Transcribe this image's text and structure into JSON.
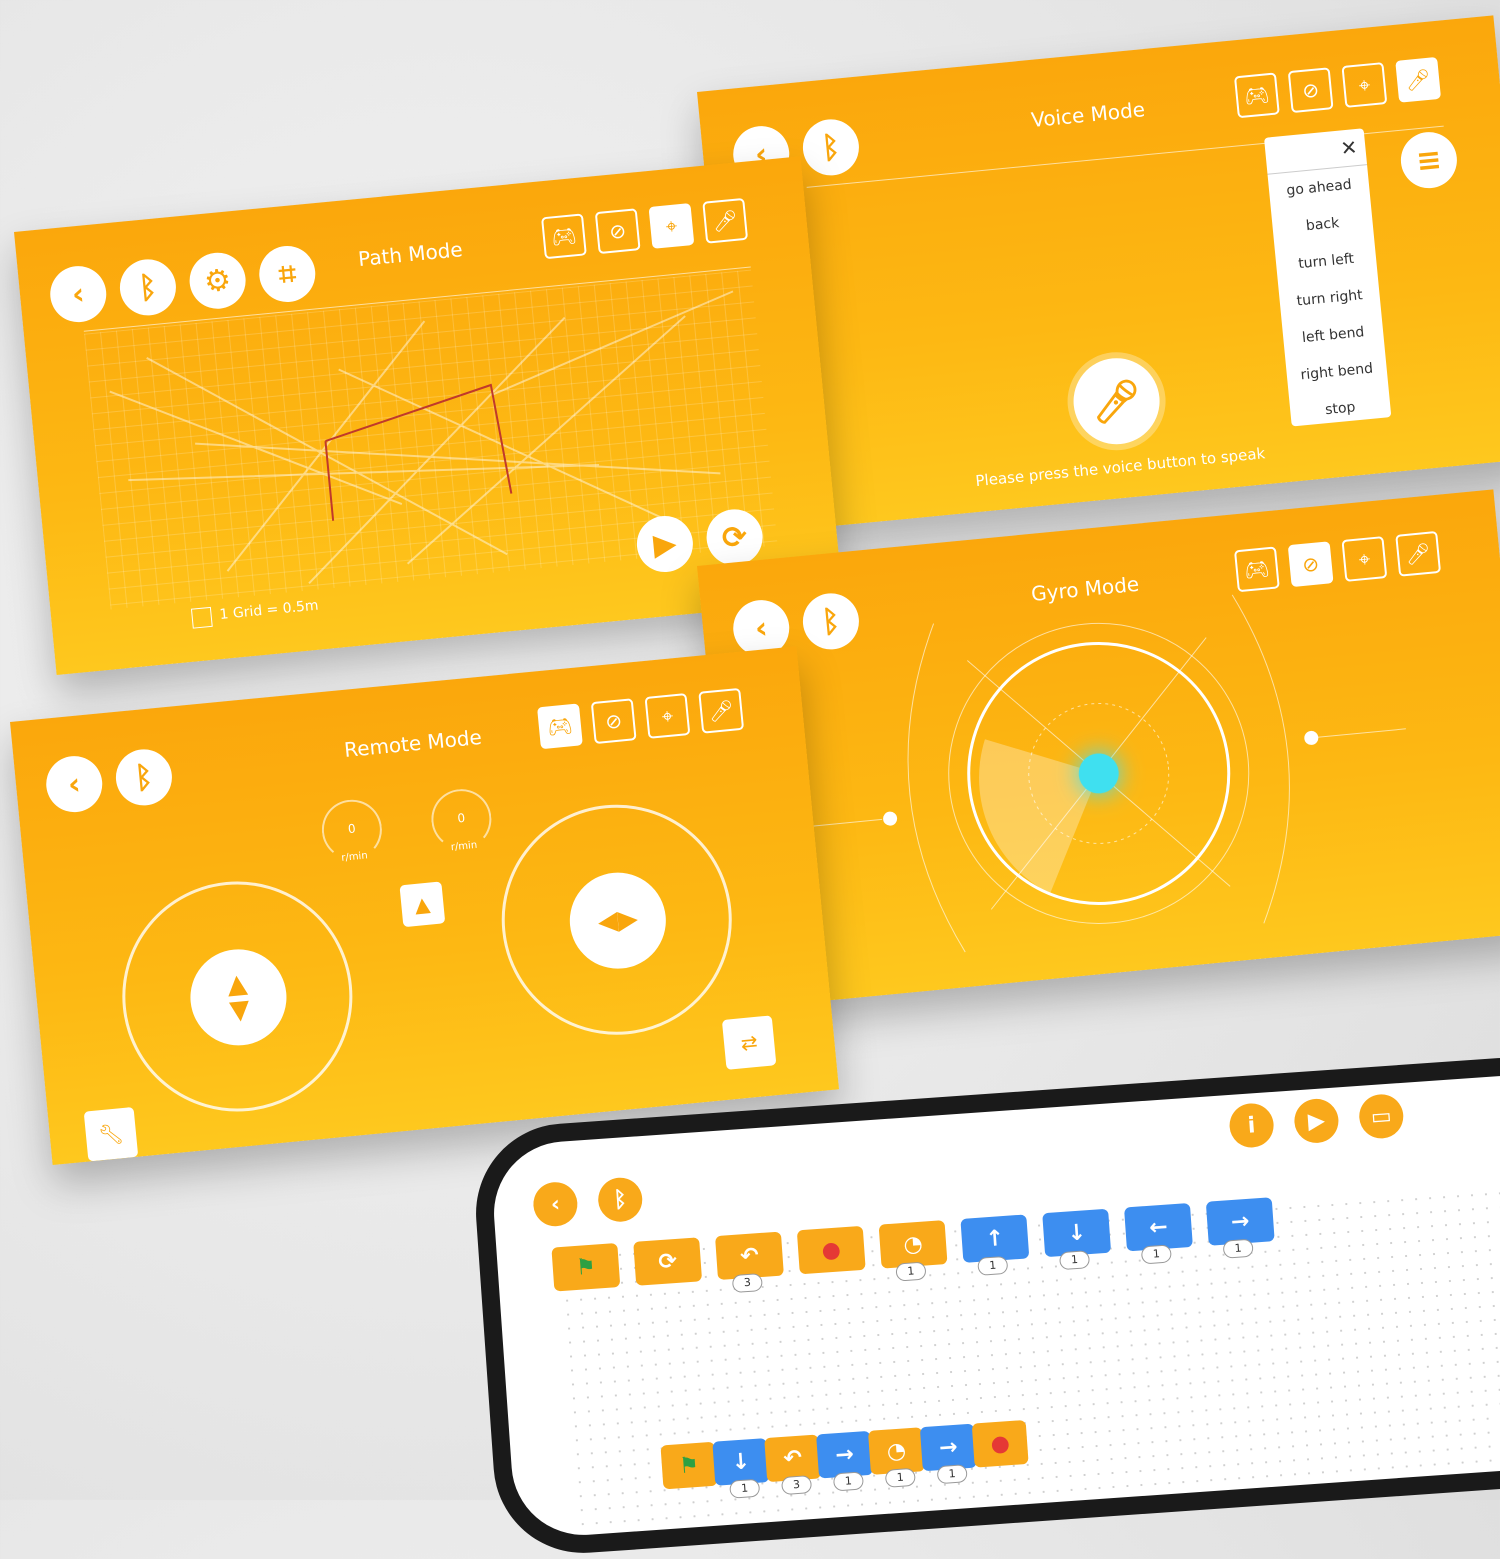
{
  "voice": {
    "title": "Voice Mode",
    "hint": "Please press the voice button to speak",
    "commands": [
      "go ahead",
      "back",
      "turn left",
      "turn right",
      "left bend",
      "right bend",
      "stop"
    ],
    "close": "✕"
  },
  "path": {
    "title": "Path Mode",
    "scale_label": "1 Grid = 0.5m"
  },
  "gyro": {
    "title": "Gyro Mode"
  },
  "remote": {
    "title": "Remote Mode",
    "left_speed": "0",
    "right_speed": "0",
    "unit": "r/min"
  },
  "icons": {
    "back": "‹",
    "bluetooth": "ᛒ",
    "gear": "⚙",
    "crop": "⌗",
    "gamepad": "🎮︎",
    "gyro": "⊘",
    "path": "⌖",
    "mic": "🎤︎",
    "play": "▶",
    "refresh": "⟳",
    "menu": "≡",
    "wrench": "🔧︎",
    "swap": "⇄",
    "rocket": "▲",
    "info": "i",
    "save": "▭"
  },
  "coding": {
    "palette": [
      {
        "type": "flag",
        "color": "org",
        "icon": "⚑"
      },
      {
        "type": "loop",
        "color": "org",
        "icon": "⟳"
      },
      {
        "type": "repeat",
        "color": "org",
        "icon": "↶",
        "num": "3"
      },
      {
        "type": "stop",
        "color": "org",
        "icon": "●"
      },
      {
        "type": "wait",
        "color": "org",
        "icon": "◔",
        "num": "1"
      },
      {
        "type": "forward",
        "color": "blu",
        "icon": "↑",
        "num": "1"
      },
      {
        "type": "backward",
        "color": "blu",
        "icon": "↓",
        "num": "1"
      },
      {
        "type": "left",
        "color": "blu",
        "icon": "←",
        "num": "1"
      },
      {
        "type": "right",
        "color": "blu",
        "icon": "→",
        "num": "1"
      }
    ],
    "program": [
      {
        "type": "flag",
        "color": "org",
        "icon": "⚑"
      },
      {
        "type": "backward",
        "color": "blu",
        "icon": "↓",
        "num": "1"
      },
      {
        "type": "repeat",
        "color": "org",
        "icon": "↶",
        "num": "3"
      },
      {
        "type": "right",
        "color": "blu",
        "icon": "→",
        "num": "1"
      },
      {
        "type": "wait",
        "color": "org",
        "icon": "◔",
        "num": "1"
      },
      {
        "type": "right",
        "color": "blu",
        "icon": "→",
        "num": "1"
      },
      {
        "type": "stop",
        "color": "org",
        "icon": "●"
      }
    ]
  },
  "colors": {
    "accent": "#fba70c",
    "blue": "#3d8ef0",
    "cyan": "#3fe0f0",
    "path": "#c0392b"
  }
}
